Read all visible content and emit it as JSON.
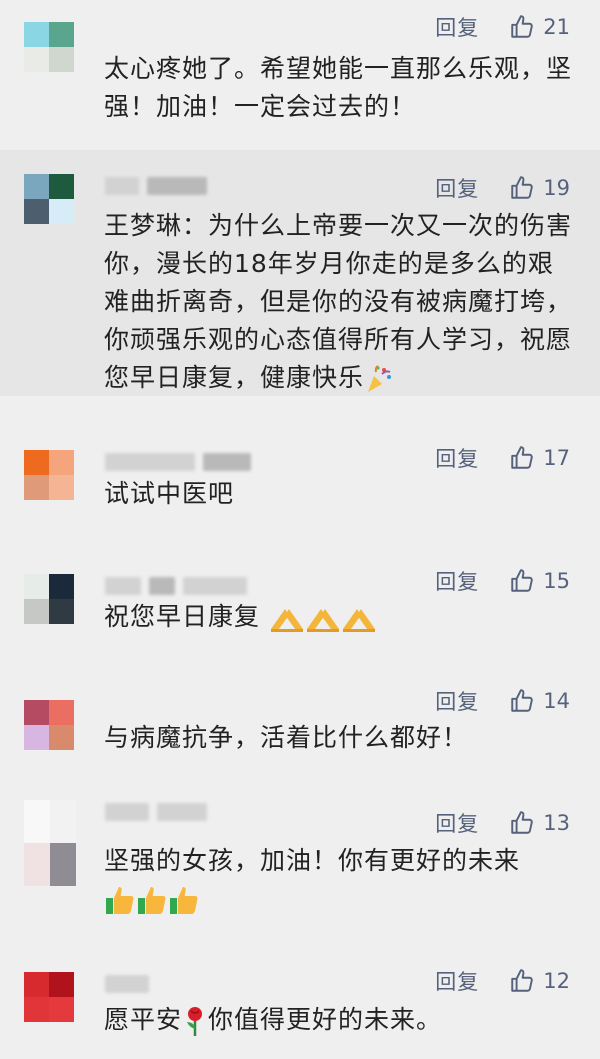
{
  "comments": [
    {
      "reply": "回复",
      "likes": "21",
      "text": "太心疼她了。希望她能一直那么乐观，坚强！加油！一定会过去的！"
    },
    {
      "reply": "回复",
      "likes": "19",
      "text": "王梦琳：为什么上帝要一次又一次的伤害你，漫长的18年岁月你走的是多么的艰难曲折离奇，但是你的没有被病魔打垮，你顽强乐观的心态值得所有人学习，祝愿您早日康复，健康快乐"
    },
    {
      "reply": "回复",
      "likes": "17",
      "text": "试试中医吧"
    },
    {
      "reply": "回复",
      "likes": "15",
      "text": "祝您早日康复"
    },
    {
      "reply": "回复",
      "likes": "14",
      "text": "与病魔抗争，活着比什么都好！"
    },
    {
      "reply": "回复",
      "likes": "13",
      "text": "坚强的女孩，加油！你有更好的未来"
    },
    {
      "reply": "回复",
      "likes": "12",
      "text_a": "愿平安",
      "text_b": "你值得更好的未来。"
    }
  ],
  "icons": {
    "like": "thumbs-up-icon",
    "confetti": "confetti-emoji",
    "pray": "pray-emoji",
    "thumb": "thumbs-up-emoji",
    "rose": "rose-emoji"
  }
}
